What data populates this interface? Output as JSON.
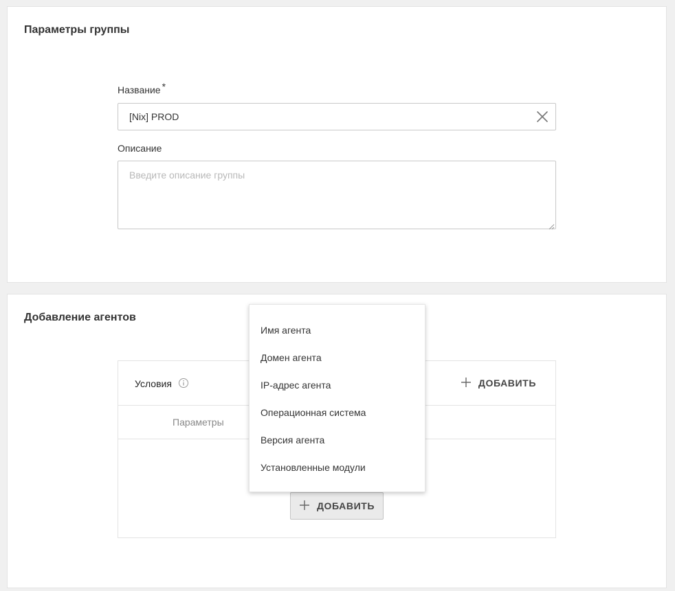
{
  "group_params": {
    "title": "Параметры группы",
    "name_label": "Название",
    "required_mark": "*",
    "name_value": "[Nix] PROD",
    "description_label": "Описание",
    "description_placeholder": "Введите описание группы",
    "description_value": ""
  },
  "agents": {
    "title": "Добавление агентов",
    "conditions_title": "Условия",
    "add_link_label": "ДОБАВИТЬ",
    "column_params": "Параметры",
    "add_button_label": "ДОБАВИТЬ"
  },
  "dropdown": {
    "items": [
      {
        "label": "Имя агента"
      },
      {
        "label": "Домен агента"
      },
      {
        "label": "IP-адрес агента"
      },
      {
        "label": "Операционная система"
      },
      {
        "label": "Версия агента"
      },
      {
        "label": "Установленные модули"
      }
    ]
  },
  "icons": {
    "clear": "close-icon",
    "info": "info-icon",
    "add": "plus-icon",
    "resize": "resize-grip-icon"
  },
  "colors": {
    "background": "#f0f0f0",
    "card": "#ffffff",
    "border": "#e3e3e3",
    "input_border": "#c8c8c8",
    "text": "#333333",
    "muted": "#888888",
    "placeholder": "#b8b8b8",
    "button_bg": "#eaeaea"
  }
}
